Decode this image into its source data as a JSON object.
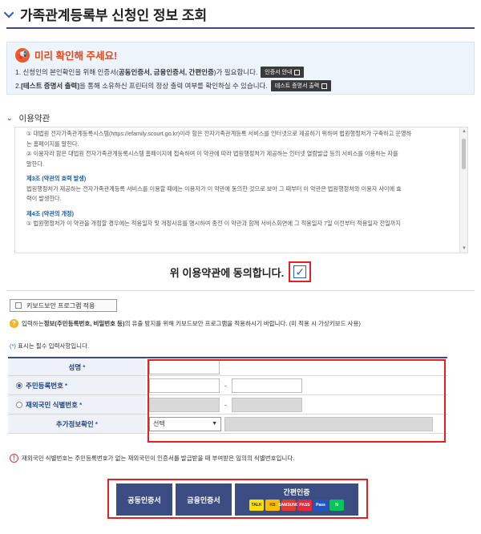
{
  "title": "가족관계등록부 신청인 정보 조회",
  "notice": {
    "heading": "미리 확인해 주세요!",
    "line1_pre": "1. 신청인의 본인확인을 위해 인증서(",
    "line1_bold": "공동인증서, 금융인증서, 간편인증",
    "line1_post": ")가 필요합니다.",
    "line1_btn": "인증서 안내",
    "line2_pre": "2. ",
    "line2_bold": "[테스트 증명서 출력]",
    "line2_post": "을 통해 소유하신 프린터의 정상 출력 여부를 확인하실 수 있습니다.",
    "line2_btn": "테스트 증명서 출력"
  },
  "terms": {
    "section_title": "이용약관",
    "lines": [
      "① 대법원 전자가족관계등록시스템(https://efamily.scourt.go.kr)이라 함은 전자가족관계등록 서비스를 인터넷으로 제공하기 위하여 법원행정처가 구축하고 운영하",
      "는 홈페이지를 말한다.",
      "② 이용자라 함은 대법원 전자가족관계등록시스템 홈페이지에 접속하여 이 약관에 따라 법원행정처가 제공하는 인터넷 열람발급 등의 서비스를 이용하는 자를",
      "말한다."
    ],
    "art3_title": "제3조 (약관의 효력 발생)",
    "art3_lines": [
      "법원행정처가 제공하는 전자가족관계등록 서비스를 이용할 때에는 이용자가 이 약관에 동의한 것으로 보아 그 때부터 이 약관은 법원행정처와 이용자 사이에 효",
      "력이 발생한다."
    ],
    "art4_title": "제4조 (약관의 개정)",
    "art4_lines": [
      "① 법원행정처가 이 약관을 개정할 경우에는 적용일자 및 개정사유를 명시하여 종전 이 약관과 함께 서비스화면에 그 적용일자 7일 이전부터 적용일자 전일까지"
    ]
  },
  "agree": {
    "label": "위 이용약관에 동의합니다.",
    "checked": true
  },
  "keyboard_security": {
    "label": "키보드보안 프로그램 적용"
  },
  "info": {
    "pre": "입력하는 ",
    "bold": "정보(주민등록번호, 비밀번호 등)",
    "post": "의 유출 방지를 위해 키보드보안 프로그램을 적용하시기 바랍니다. (미 적용 시 가상키보드 사용)"
  },
  "required_note": {
    "star": "(*)",
    "text": " 표시는 필수 입력사항입니다."
  },
  "form": {
    "name_label": "성명",
    "rrn_label": "주민등록번호",
    "foreign_label": "재외국민 식별번호",
    "extra_label": "추가정보확인",
    "star": "*",
    "dash": "-",
    "select_value": "선택",
    "rrn_selected": true
  },
  "warning": {
    "text": "재외국민 식별번호는 주민등록번호가 없는 재외국민이 인증서를 발급받을 때 부여받은 임의의 식별번호입니다."
  },
  "buttons": {
    "joint_cert": "공동인증서",
    "finance_cert": "금융인증서",
    "simple_auth": "간편인증",
    "logos": [
      {
        "name": "kakao",
        "text": "TALK",
        "bg": "#fae100",
        "fg": "#3a1d1d"
      },
      {
        "name": "kb",
        "text": "KB",
        "bg": "#ffbc00",
        "fg": "#5a4a00"
      },
      {
        "name": "samsung",
        "text": "SAMSUNG",
        "bg": "#e8382f",
        "fg": "#ffffff"
      },
      {
        "name": "pass",
        "text": "PASS",
        "bg": "#e8283c",
        "fg": "#ffffff"
      },
      {
        "name": "shinhan",
        "text": "Pass",
        "bg": "#1f56c4",
        "fg": "#ffffff"
      },
      {
        "name": "naver",
        "text": "N",
        "bg": "#03c75a",
        "fg": "#ffffff"
      }
    ]
  },
  "colors": {
    "accent": "#2d5fc3",
    "highlight": "#e52020",
    "button": "#3b4d82"
  }
}
